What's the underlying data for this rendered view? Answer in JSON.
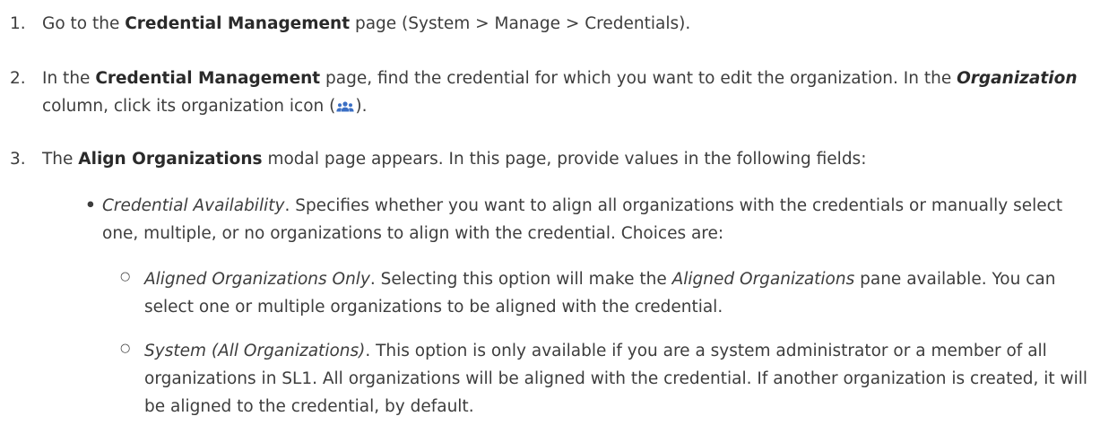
{
  "steps": [
    {
      "number": "1.",
      "t1": "Go to the ",
      "b1": "Credential Management",
      "t2": " page (System > Manage > Credentials)."
    },
    {
      "number": "2.",
      "t1": "In the ",
      "b1": "Credential Management",
      "t2": " page, find the credential for which you want to edit the organization. In the ",
      "bi1": "Organization",
      "t3": " column, click its organization icon (",
      "icon": "organization-icon",
      "t4": ")."
    },
    {
      "number": "3.",
      "b1": "Align Organizations",
      "t2": " modal page appears. In this page, provide values in the following fields:",
      "t1": "The "
    }
  ],
  "bullets": [
    {
      "field": "Credential Availability",
      "desc": ". Specifies whether you want to align all organizations with the credentials or manually select one, multiple, or no organizations to align with the credential. Choices are:"
    }
  ],
  "choices": [
    {
      "name": "Aligned Organizations Only",
      "desc1": ". Selecting this option will make the ",
      "em": "Aligned Organizations",
      "desc2": " pane available. You can select one or multiple organizations to be aligned with the credential."
    },
    {
      "name": "System (All Organizations)",
      "desc1": ". This option is only available if you are a system administrator or a member of all organizations in SL1. All organizations will be aligned with the credential. If another organization is created, it will be aligned to the credential, by default."
    }
  ],
  "colors": {
    "text": "#3d3d3d",
    "icon": "#3b6fc4"
  }
}
